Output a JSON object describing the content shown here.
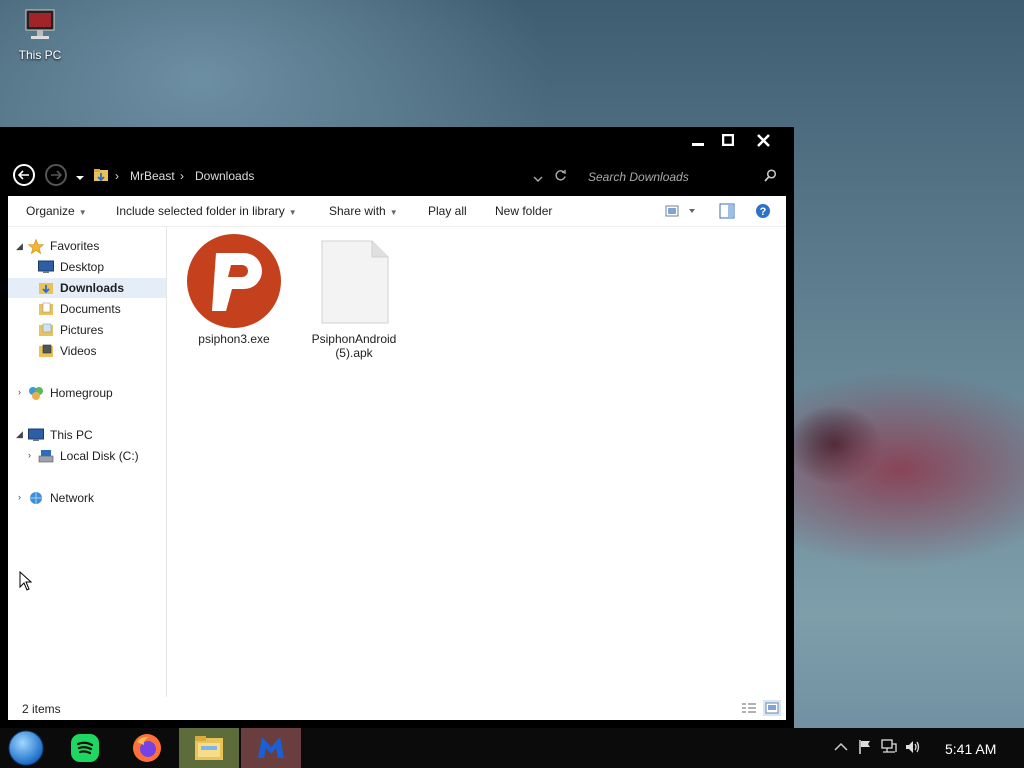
{
  "desktop": {
    "icon_label": "This PC"
  },
  "window": {
    "breadcrumb": [
      "MrBeast",
      "Downloads"
    ],
    "search_placeholder": "Search Downloads"
  },
  "toolbar": {
    "organize": "Organize",
    "include": "Include selected folder in library",
    "share": "Share with",
    "play": "Play all",
    "new_folder": "New folder"
  },
  "nav": {
    "favorites": "Favorites",
    "desktop": "Desktop",
    "downloads": "Downloads",
    "documents": "Documents",
    "pictures": "Pictures",
    "videos": "Videos",
    "homegroup": "Homegroup",
    "this_pc": "This PC",
    "local_disk": "Local Disk (C:)",
    "network": "Network"
  },
  "files": [
    {
      "name": "psiphon3.exe"
    },
    {
      "name": "PsiphonAndroid (5).apk"
    }
  ],
  "status": {
    "items": "2 items"
  },
  "taskbar": {
    "time": "5:41 AM"
  },
  "colors": {
    "psiphon": "#c5411e",
    "accent": "#1f6fd1"
  }
}
